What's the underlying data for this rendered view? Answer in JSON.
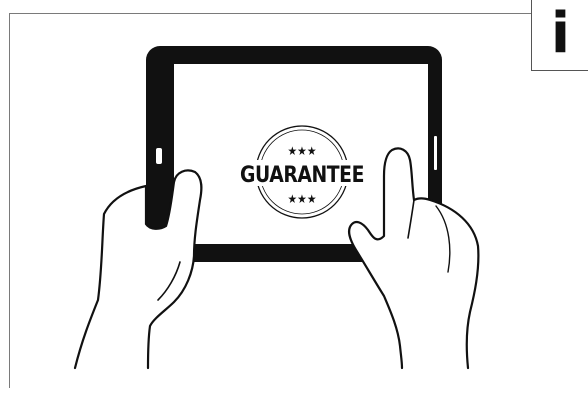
{
  "seal": {
    "text": "GUARANTEE",
    "top_stars": "★★★",
    "bottom_stars": "★★★"
  },
  "info": {
    "glyph": "i"
  },
  "colors": {
    "ink": "#111111",
    "screen": "#ffffff",
    "frame_line": "#7a7a7a",
    "background": "#ffffff"
  }
}
